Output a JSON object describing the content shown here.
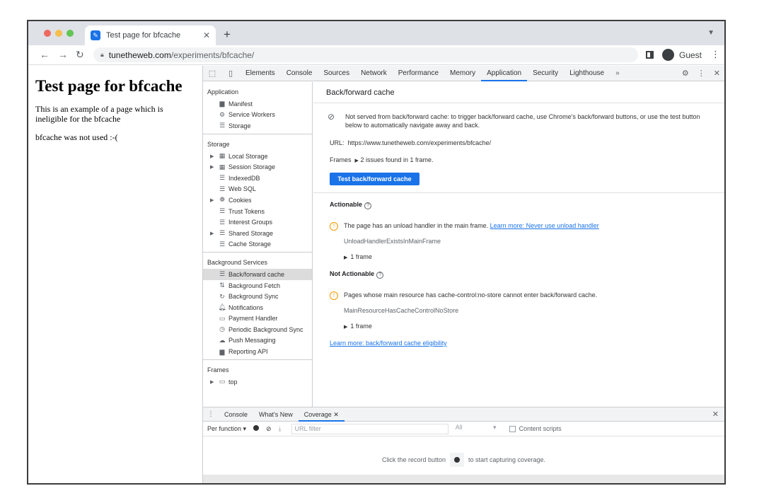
{
  "browser": {
    "tab_title": "Test page for bfcache",
    "tab_close": "✕",
    "new_tab": "+",
    "url_host": "tunetheweb.com",
    "url_path": "/experiments/bfcache/",
    "profile": "Guest"
  },
  "page": {
    "heading": "Test page for bfcache",
    "description": "This is an example of a page which is ineligible for the bfcache",
    "status": "bfcache was not used :-("
  },
  "devtools": {
    "tabs": [
      "Elements",
      "Console",
      "Sources",
      "Network",
      "Performance",
      "Memory",
      "Application",
      "Security",
      "Lighthouse"
    ],
    "active_tab": "Application",
    "more_tabs": "»",
    "sidebar": {
      "application_header": "Application",
      "application_items": [
        "Manifest",
        "Service Workers",
        "Storage"
      ],
      "storage_header": "Storage",
      "storage_items": [
        "Local Storage",
        "Session Storage",
        "IndexedDB",
        "Web SQL",
        "Cookies",
        "Trust Tokens",
        "Interest Groups",
        "Shared Storage",
        "Cache Storage"
      ],
      "background_header": "Background Services",
      "background_items": [
        "Back/forward cache",
        "Background Fetch",
        "Background Sync",
        "Notifications",
        "Payment Handler",
        "Periodic Background Sync",
        "Push Messaging",
        "Reporting API"
      ],
      "frames_header": "Frames",
      "frames_items": [
        "top"
      ]
    },
    "main": {
      "title": "Back/forward cache",
      "notice": "Not served from back/forward cache: to trigger back/forward cache, use Chrome's back/forward buttons, or use the test button below to automatically navigate away and back.",
      "url_label": "URL:",
      "url_value": "https://www.tunetheweb.com/experiments/bfcache/",
      "frames_label": "Frames",
      "frames_value": "2 issues found in 1 frame.",
      "test_button": "Test back/forward cache",
      "actionable_header": "Actionable",
      "actionable_issue": "The page has an unload handler in the main frame.",
      "actionable_link": "Learn more: Never use unload handler",
      "actionable_reason": "UnloadHandlerExistsInMainFrame",
      "actionable_frames": "1 frame",
      "not_actionable_header": "Not Actionable",
      "not_actionable_issue": "Pages whose main resource has cache-control:no-store cannot enter back/forward cache.",
      "not_actionable_reason": "MainResourceHasCacheControlNoStore",
      "not_actionable_frames": "1 frame",
      "learn_more": "Learn more: back/forward cache eligibility"
    },
    "drawer": {
      "tabs": [
        "Console",
        "What's New",
        "Coverage"
      ],
      "active_tab": "Coverage",
      "per_function": "Per function ▾",
      "url_filter_placeholder": "URL filter",
      "type_select": "All",
      "content_scripts": "Content scripts",
      "empty_before": "Click the record button",
      "empty_after": "to start capturing coverage."
    }
  }
}
